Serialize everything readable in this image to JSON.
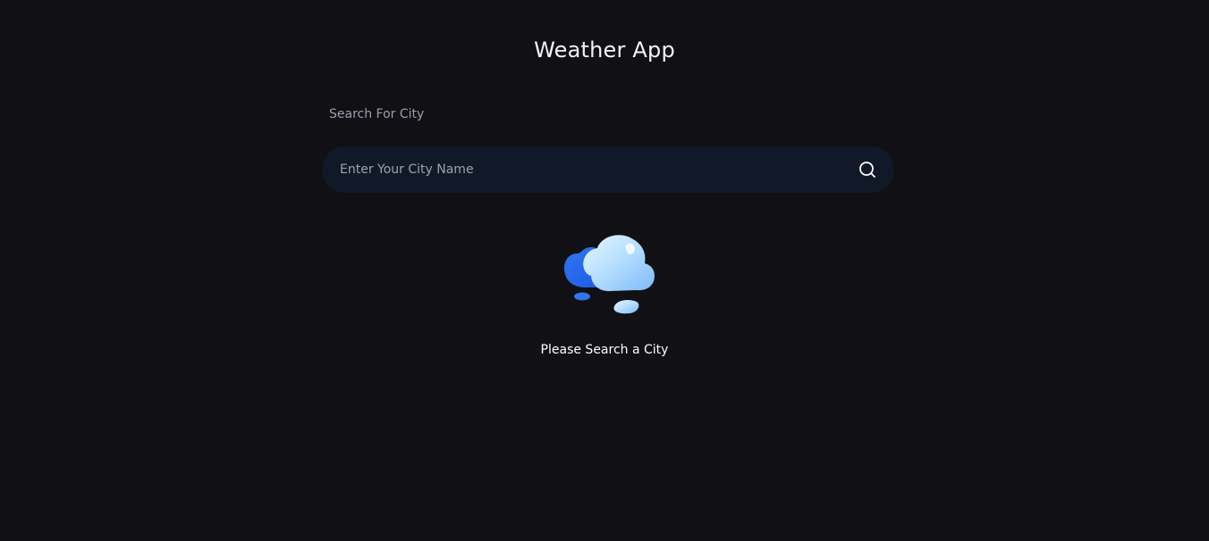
{
  "app": {
    "title": "Weather App"
  },
  "search": {
    "label": "Search For City",
    "placeholder": "Enter Your City Name",
    "value": "",
    "button_icon": "search-icon"
  },
  "empty_state": {
    "icon": "cloud-icon",
    "message": "Please Search a City"
  },
  "colors": {
    "background": "#101015",
    "input_background": "#111827",
    "cloud_front": "#bfe3ff",
    "cloud_back": "#3b82f6"
  }
}
